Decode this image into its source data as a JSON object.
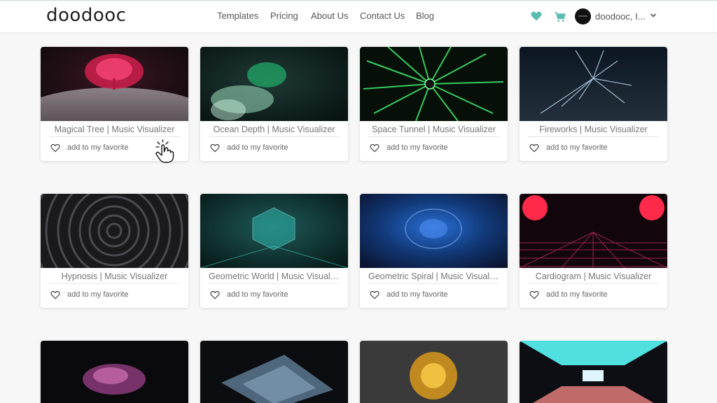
{
  "header": {
    "logo": "doodooc",
    "nav": [
      {
        "label": "Templates"
      },
      {
        "label": "Pricing"
      },
      {
        "label": "About Us"
      },
      {
        "label": "Contact Us"
      },
      {
        "label": "Blog"
      }
    ],
    "account_label": "doodooc, I...",
    "icons": [
      "heart-icon",
      "cart-icon",
      "avatar",
      "chevron-down-icon"
    ],
    "accent": "#5bbdb0"
  },
  "favorite_label": "add to my favorite",
  "cards": [
    {
      "title": "Magical Tree | Music Visualizer"
    },
    {
      "title": "Ocean Depth | Music Visualizer"
    },
    {
      "title": "Space Tunnel | Music Visualizer"
    },
    {
      "title": "Fireworks | Music Visualizer"
    },
    {
      "title": "Hypnosis | Music Visualizer"
    },
    {
      "title": "Geometric World | Music Visualizer"
    },
    {
      "title": "Geometric Spiral | Music Visualizer"
    },
    {
      "title": "Cardiogram | Music Visualizer"
    }
  ],
  "cursor": "pointer-hand-icon"
}
